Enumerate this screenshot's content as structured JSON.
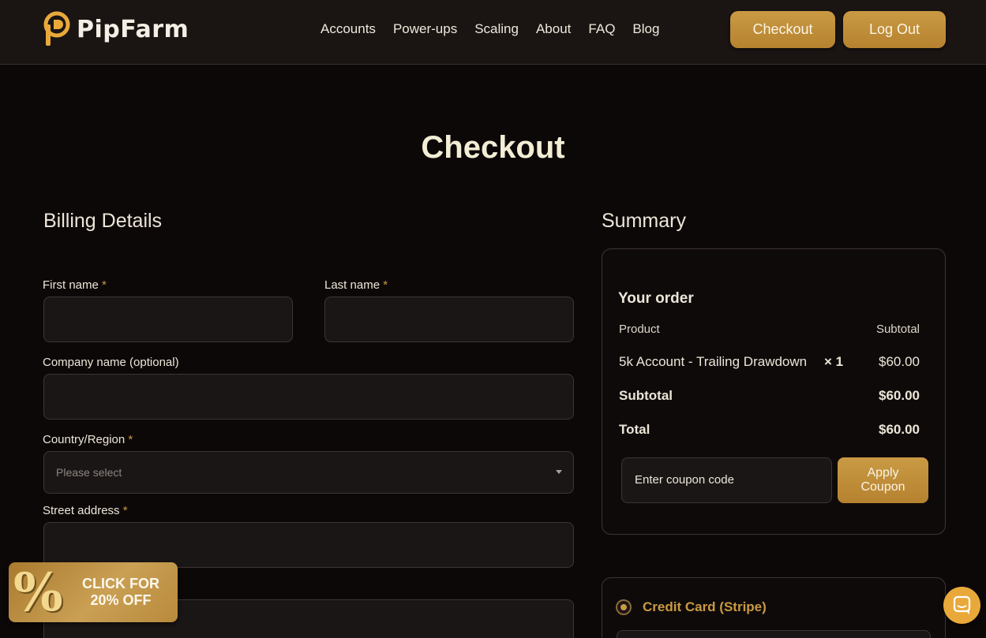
{
  "header": {
    "brand": "PipFarm",
    "nav": [
      "Accounts",
      "Power-ups",
      "Scaling",
      "About",
      "FAQ",
      "Blog"
    ],
    "checkout_label": "Checkout",
    "logout_label": "Log Out"
  },
  "page": {
    "title": "Checkout"
  },
  "billing": {
    "title": "Billing Details",
    "required_mark": "*",
    "first_name_label": "First name",
    "last_name_label": "Last name",
    "company_label": "Company name (optional)",
    "country_label": "Country/Region",
    "country_placeholder": "Please select",
    "street_label": "Street address"
  },
  "summary": {
    "title": "Summary",
    "order_title": "Your order",
    "product_header": "Product",
    "subtotal_header": "Subtotal",
    "item": {
      "name": "5k Account - Trailing Drawdown",
      "qty": "× 1",
      "price": "$60.00"
    },
    "subtotal_label": "Subtotal",
    "subtotal_value": "$60.00",
    "total_label": "Total",
    "total_value": "$60.00",
    "coupon_placeholder": "Enter coupon code",
    "apply_label_line1": "Apply",
    "apply_label_line2": "Coupon"
  },
  "payment": {
    "method_label": "Credit Card (Stripe)"
  },
  "promo": {
    "icon_text": "%",
    "line1": "CLICK FOR",
    "line2": "20% OFF"
  },
  "colors": {
    "accent": "#c99a44",
    "background": "#0d0808",
    "header": "#1a1413"
  }
}
